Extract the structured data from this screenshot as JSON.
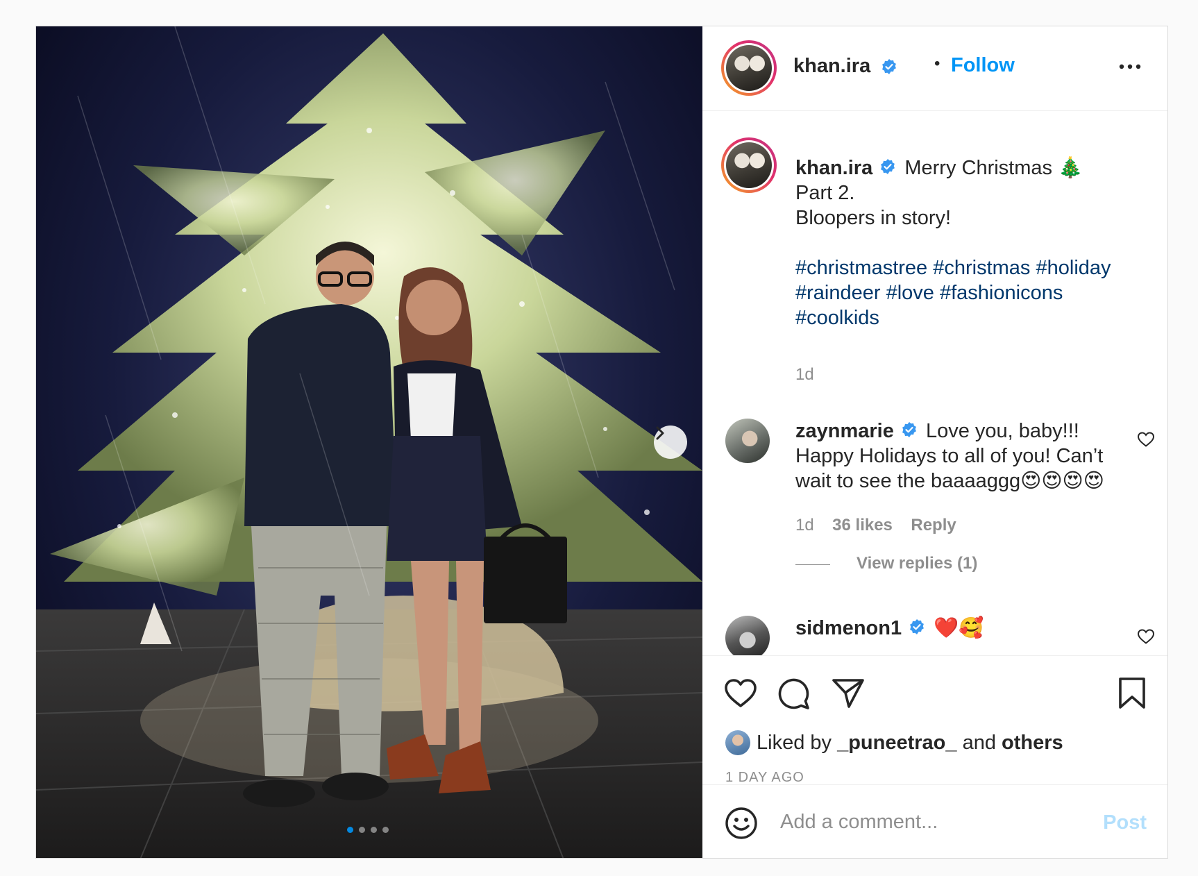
{
  "post": {
    "author": "khan.ira",
    "separator": "•",
    "follow_label": "Follow",
    "more_icon": "more-horizontal-icon",
    "caption": {
      "username": "khan.ira",
      "line1": "Merry Christmas 🎄",
      "line2": "Part 2.",
      "line3": "Bloopers in story!",
      "hashtags_line1": [
        "#christmastree",
        "#christmas",
        "#holiday"
      ],
      "hashtags_line2": [
        "#raindeer",
        "#love",
        "#fashionicons"
      ],
      "hashtags_line3": [
        "#coolkids"
      ],
      "time": "1d"
    },
    "comments": [
      {
        "username": "zaynmarie",
        "line1": "Love you, baby!!!",
        "line2": "Happy Holidays to all of you! Can’t",
        "line3": "wait to see the baaaaggg😍😍😍😍",
        "time": "1d",
        "likes": "36 likes",
        "reply_label": "Reply",
        "view_replies": "View replies (1)"
      },
      {
        "username": "sidmenon1",
        "text": "❤️🥰"
      }
    ],
    "liked_by_prefix": "Liked by",
    "liked_by_user": "_puneetrao_",
    "liked_by_and": "and",
    "liked_by_others": "others",
    "time_ago": "1 DAY AGO",
    "comment_placeholder": "Add a comment...",
    "post_label": "Post",
    "carousel": {
      "slides": 4,
      "active": 1
    }
  },
  "colors": {
    "link_blue": "#0095f6",
    "hashtag": "#00376b",
    "muted": "#8e8e8e",
    "verified": "#3897f0",
    "post_disabled": "#b2dffc"
  }
}
